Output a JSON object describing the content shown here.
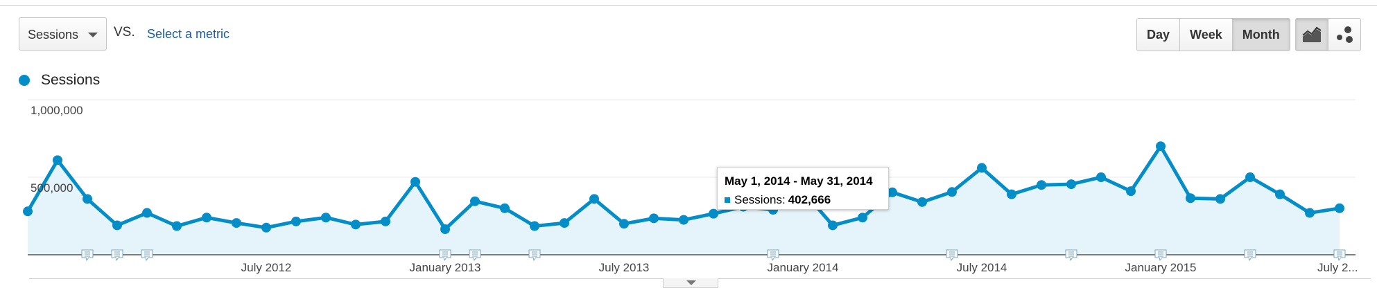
{
  "controls": {
    "metric_select": "Sessions",
    "vs_label": "VS.",
    "select_metric_link": "Select a metric",
    "granularity": [
      "Day",
      "Week",
      "Month"
    ],
    "granularity_active": "Month",
    "view_buttons": [
      "line-chart-icon",
      "motion-chart-icon"
    ],
    "view_active": "line-chart-icon"
  },
  "legend": {
    "label": "Sessions",
    "color": "#058dc7"
  },
  "tooltip": {
    "title": "May 1, 2014 - May 31, 2014",
    "series_label": "Sessions:",
    "value": "402,666"
  },
  "chart_data": {
    "type": "area",
    "series": [
      {
        "name": "Sessions",
        "x": [
          "2011-11",
          "2011-12",
          "2012-01",
          "2012-02",
          "2012-03",
          "2012-04",
          "2012-05",
          "2012-06",
          "2012-07",
          "2012-08",
          "2012-09",
          "2012-10",
          "2012-11",
          "2012-12",
          "2013-01",
          "2013-02",
          "2013-03",
          "2013-04",
          "2013-05",
          "2013-06",
          "2013-07",
          "2013-08",
          "2013-09",
          "2013-10",
          "2013-11",
          "2013-12",
          "2014-01",
          "2014-02",
          "2014-03",
          "2014-04",
          "2014-05",
          "2014-06",
          "2014-07",
          "2014-08",
          "2014-09",
          "2014-10",
          "2014-11",
          "2014-12",
          "2015-01",
          "2015-02",
          "2015-03",
          "2015-04",
          "2015-05",
          "2015-06",
          "2015-07"
        ],
        "values": [
          280000,
          610000,
          360000,
          190000,
          270000,
          185000,
          240000,
          205000,
          175000,
          215000,
          240000,
          195000,
          215000,
          470000,
          165000,
          345000,
          300000,
          185000,
          205000,
          360000,
          200000,
          235000,
          225000,
          265000,
          310000,
          290000,
          410000,
          190000,
          240000,
          402666,
          340000,
          405000,
          560000,
          390000,
          450000,
          455000,
          500000,
          410000,
          700000,
          365000,
          360000,
          500000,
          390000,
          270000,
          300000
        ]
      }
    ],
    "color": "#058dc7",
    "area_fill": "#e5f3fa",
    "y_ticks": [
      "500,000",
      "1,000,000"
    ],
    "y_tick_values": [
      500000,
      1000000
    ],
    "x_tick_labels": [
      "July 2012",
      "January 2013",
      "July 2013",
      "January 2014",
      "July 2014",
      "January 2015",
      "July 2..."
    ],
    "x_tick_months": [
      "2012-07",
      "2013-01",
      "2013-07",
      "2014-01",
      "2014-07",
      "2015-01",
      "2015-07"
    ],
    "ylim": [
      0,
      1000000
    ],
    "annotation_months": [
      "2012-01",
      "2012-02",
      "2012-03",
      "2013-01",
      "2013-02",
      "2013-04",
      "2013-12",
      "2014-06",
      "2014-10",
      "2015-01",
      "2015-04",
      "2015-07"
    ],
    "grid": true,
    "legend_position": "top-left"
  }
}
